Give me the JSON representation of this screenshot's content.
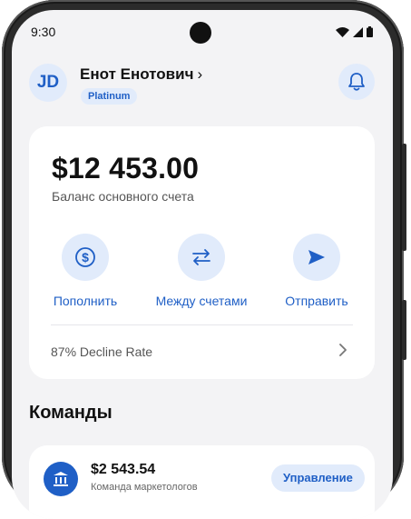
{
  "status_bar": {
    "time": "9:30"
  },
  "profile": {
    "initials": "JD",
    "name": "Енот Енотович",
    "tier": "Platinum"
  },
  "balance": {
    "amount": "$12 453.00",
    "label": "Баланс основного счета"
  },
  "actions": [
    {
      "label": "Пополнить",
      "icon": "dollar-icon"
    },
    {
      "label": "Между счетами",
      "icon": "transfer-arrows-icon"
    },
    {
      "label": "Отправить",
      "icon": "send-icon"
    }
  ],
  "decline_rate": {
    "label": "87% Decline Rate"
  },
  "teams": {
    "title": "Команды",
    "items": [
      {
        "amount": "$2 543.54",
        "name": "Команда маркетологов",
        "button": "Управление",
        "icon": "bank-icon"
      }
    ]
  },
  "colors": {
    "accent": "#1f5fc6",
    "accent_light": "#e1ebfb",
    "background": "#f3f3f5",
    "card": "#ffffff"
  }
}
